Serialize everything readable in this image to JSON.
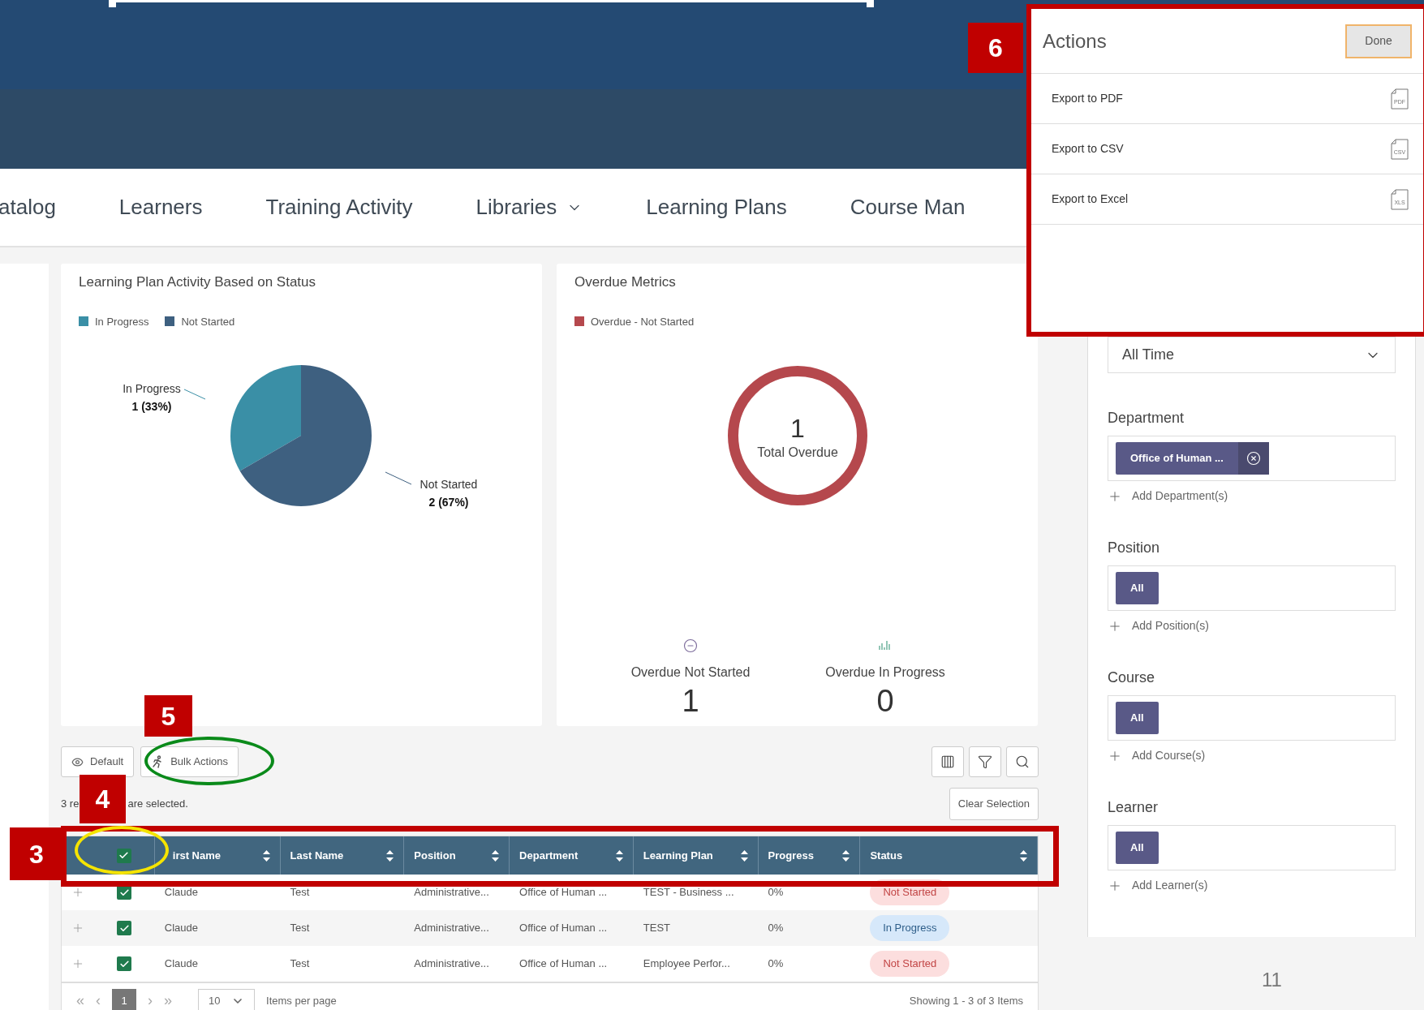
{
  "nav": {
    "items": [
      {
        "label": "atalog",
        "dropdown": false
      },
      {
        "label": "Learners",
        "dropdown": false
      },
      {
        "label": "Training Activity",
        "dropdown": false
      },
      {
        "label": "Libraries",
        "dropdown": true
      },
      {
        "label": "Learning Plans",
        "dropdown": false
      },
      {
        "label": "Course Man",
        "dropdown": false
      }
    ]
  },
  "status_chart": {
    "title": "Learning Plan Activity Based on Status",
    "legend": [
      {
        "label": "In Progress",
        "color": "#3a8fa6"
      },
      {
        "label": "Not Started",
        "color": "#3e6080"
      }
    ],
    "chart_data": {
      "type": "pie",
      "categories": [
        "In Progress",
        "Not Started"
      ],
      "values": [
        1,
        2
      ],
      "value_labels": [
        "1 (33%)",
        "2 (67%)"
      ]
    }
  },
  "overdue_card": {
    "title": "Overdue Metrics",
    "legend": [
      {
        "label": "Overdue - Not Started",
        "color": "#b5484d"
      }
    ],
    "center_value": "1",
    "center_label": "Total Overdue",
    "metrics": [
      {
        "kind": "not_started",
        "label": "Overdue Not Started",
        "value": "1"
      },
      {
        "kind": "in_progress",
        "label": "Overdue In Progress",
        "value": "0"
      }
    ]
  },
  "toolbar": {
    "buttons": [
      {
        "kind": "view",
        "label": "Default"
      },
      {
        "kind": "bulk",
        "label": "Bulk Actions"
      }
    ],
    "icon_buttons": [
      {
        "kind": "columns"
      },
      {
        "kind": "filter"
      },
      {
        "kind": "search"
      }
    ]
  },
  "selection": {
    "text_start": "3 re",
    "text_end": "are selected.",
    "clear": "Clear Selection"
  },
  "table": {
    "header_checked": true,
    "columns": [
      "irst Name",
      "Last Name",
      "Position",
      "Department",
      "Learning Plan",
      "Progress",
      "Status"
    ],
    "rows": [
      {
        "checked": true,
        "cells": [
          "Claude",
          "Test",
          "Administrative...",
          "Office of Human ...",
          "TEST - Business ...",
          "0%"
        ],
        "status": {
          "text": "Not Started",
          "kind": "not_started"
        }
      },
      {
        "checked": true,
        "cells": [
          "Claude",
          "Test",
          "Administrative...",
          "Office of Human ...",
          "TEST",
          "0%"
        ],
        "status": {
          "text": "In Progress",
          "kind": "in_progress"
        }
      },
      {
        "checked": true,
        "cells": [
          "Claude",
          "Test",
          "Administrative...",
          "Office of Human ...",
          "Employee Perfor...",
          "0%"
        ],
        "status": {
          "text": "Not Started",
          "kind": "not_started"
        }
      }
    ]
  },
  "pagination": {
    "first": "«",
    "prev": "‹",
    "pages": [
      {
        "label": "1",
        "selected": true
      }
    ],
    "next": "›",
    "last": "»",
    "page_size": "10",
    "page_size_label": "Items per page",
    "summary": "Showing 1 - 3 of 3 Items"
  },
  "filters": {
    "time": "All Time",
    "groups": [
      {
        "label": "Department",
        "chips": [
          {
            "text": "Office of Human ...",
            "removable": true
          }
        ],
        "add": "Add Department(s)"
      },
      {
        "label": "Position",
        "chips": [
          {
            "text": "All",
            "removable": false
          }
        ],
        "add": "Add Position(s)"
      },
      {
        "label": "Course",
        "chips": [
          {
            "text": "All",
            "removable": false
          }
        ],
        "add": "Add Course(s)"
      },
      {
        "label": "Learner",
        "chips": [
          {
            "text": "All",
            "removable": false
          }
        ],
        "add": "Add Learner(s)"
      }
    ]
  },
  "actions_panel": {
    "title": "Actions",
    "done": "Done",
    "items": [
      {
        "label": "Export to PDF",
        "icon_text": "PDF"
      },
      {
        "label": "Export to CSV",
        "icon_text": "CSV"
      },
      {
        "label": "Export to Excel",
        "icon_text": "XLS"
      }
    ]
  },
  "callouts": [
    "3",
    "4",
    "5",
    "6"
  ],
  "page_number": "11"
}
